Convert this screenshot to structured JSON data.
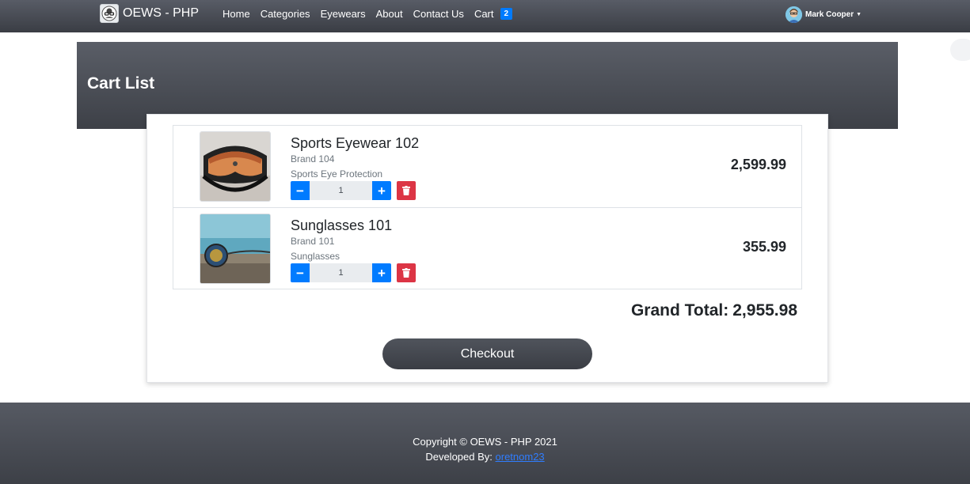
{
  "navbar": {
    "brand": "OEWS - PHP",
    "links": [
      "Home",
      "Categories",
      "Eyewears",
      "About",
      "Contact Us"
    ],
    "cart_label": "Cart",
    "cart_count": "2",
    "user_name": "Mark Cooper"
  },
  "header": {
    "title": "Cart List"
  },
  "cart": {
    "items": [
      {
        "name": "Sports Eyewear 102",
        "brand": "Brand 104",
        "category": "Sports Eye Protection",
        "qty": "1",
        "price": "2,599.99"
      },
      {
        "name": "Sunglasses 101",
        "brand": "Brand 101",
        "category": "Sunglasses",
        "qty": "1",
        "price": "355.99"
      }
    ],
    "grand_total_label": "Grand Total:",
    "grand_total": "2,955.98",
    "checkout_label": "Checkout"
  },
  "footer": {
    "copyright": "Copyright © OEWS - PHP 2021",
    "developed_by": "Developed By:",
    "developer": "oretnom23"
  },
  "colors": {
    "primary": "#007bff",
    "danger": "#dc3545",
    "dark": "#3d4047"
  }
}
